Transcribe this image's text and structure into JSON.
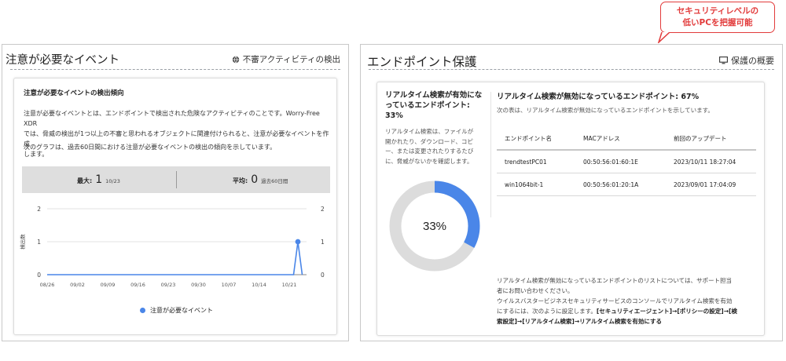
{
  "left_panel": {
    "title": "注意が必要なイベント",
    "link_label": "不審アクティビティの検出",
    "link_icon": "globe-icon",
    "card": {
      "title": "注意が必要なイベントの検出傾向",
      "desc_line1": "注意が必要なイベントとは、エンドポイントで検出された危険なアクティビティのことです。Worry-Free XDR",
      "desc_line2": "では、脅威の検出が1つ以上の不審と思われるオブジェクトに関連付けられると、注意が必要なイベントを作成",
      "desc_line3": "します。",
      "desc2": "次のグラフは、過去60日間における注意が必要なイベントの検出の傾向を示しています。",
      "stats": {
        "max_label": "最大:",
        "max_value": "1",
        "max_sub": "10/23",
        "avg_label": "平均:",
        "avg_value": "0",
        "avg_sub": "過去60日間"
      }
    },
    "legend": "注意が必要なイベント"
  },
  "chart_data": {
    "type": "line",
    "title": "",
    "xlabel": "",
    "ylabel": "検出数",
    "categories": [
      "08/26",
      "09/02",
      "09/09",
      "09/16",
      "09/23",
      "09/30",
      "10/07",
      "10/14",
      "10/21"
    ],
    "ylim": [
      0,
      2
    ],
    "yticks": [
      0,
      1,
      2
    ],
    "series": [
      {
        "name": "注意が必要なイベント",
        "color": "#4a86e8",
        "points": [
          {
            "x": "2023-08-26",
            "y": 0
          },
          {
            "x": "2023-10-22",
            "y": 0
          },
          {
            "x": "2023-10-23",
            "y": 1
          },
          {
            "x": "2023-10-24",
            "y": 0
          }
        ]
      }
    ],
    "grid": true,
    "legend_position": "bottom"
  },
  "right_panel": {
    "title": "エンドポイント保護",
    "link_label": "保護の概要",
    "link_icon": "monitor-icon",
    "left_col": {
      "title_line1": "リアルタイム検索が有効にな",
      "title_line2": "っているエンドポイント:",
      "title_line3": "33%",
      "desc_line1": "リアルタイム検索は、ファイルが",
      "desc_line2": "開かれたり、ダウンロード、コピ",
      "desc_line3": "ー、または変更されたりするたび",
      "desc_line4": "に、脅威がないかを確認します。",
      "donut_percent": 33,
      "donut_label": "33%",
      "donut_color": "#4a86e8",
      "donut_track_color": "#dcdcdc"
    },
    "right_col": {
      "title": "リアルタイム検索が無効になっているエンドポイント: 67%",
      "subtitle": "次の表は、リアルタイム検索が無効になっているエンドポイントを示しています。",
      "table": {
        "headers": [
          "エンドポイント名",
          "MACアドレス",
          "前回のアップデート"
        ],
        "rows": [
          [
            "trendtestPC01",
            "00:50:56:01:60:1E",
            "2023/10/11 18:27:04"
          ],
          [
            "win1064bit-1",
            "00:50:56:01:20:1A",
            "2023/09/01 17:04:09"
          ]
        ]
      },
      "note_line1": "リアルタイム検索が無効になっているエンドポイントのリストについては、サポート担当",
      "note_line2": "者にお問い合わせください。",
      "note_line3": "ウイルスバスタービジネスセキュリティサービスのコンソールでリアルタイム検索を有効",
      "note_line4a": "にするには、次のように設定します。",
      "note_line4b": "[セキュリティエージェント]→[ポリシーの設定]→[検",
      "note_line5": "索設定]→[リアルタイム検索]→リアルタイム検索を有効にする"
    }
  },
  "callout": {
    "line1": "セキュリティレベルの",
    "line2": "低いPCを把握可能",
    "color": "#e23b3b"
  }
}
